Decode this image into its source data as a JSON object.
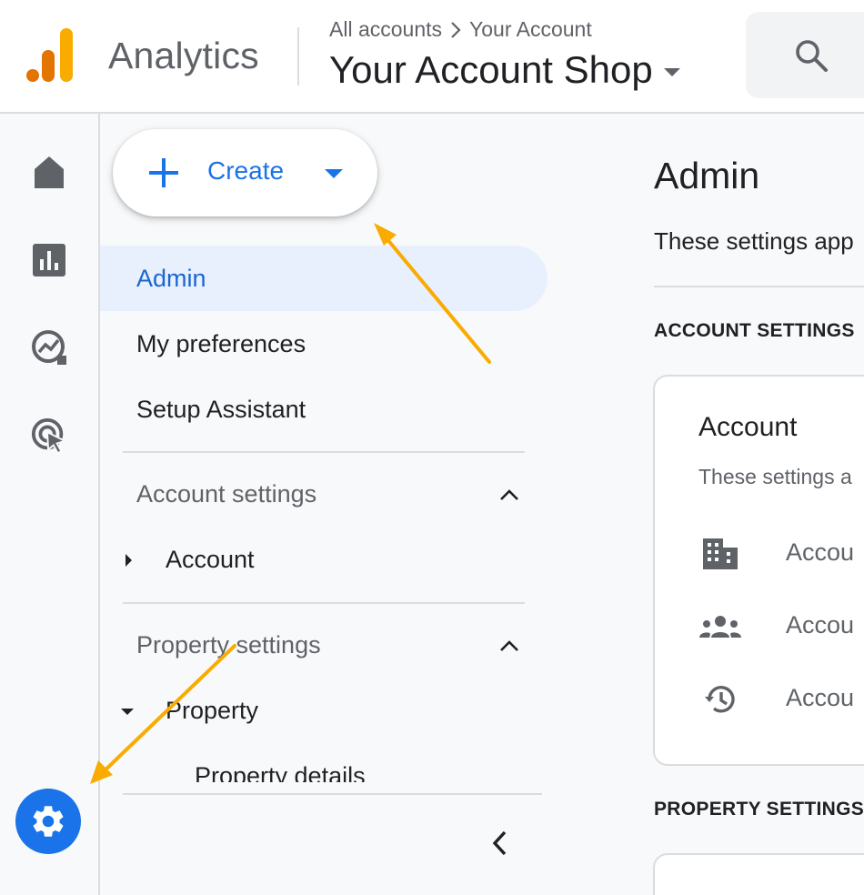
{
  "header": {
    "app_name": "Analytics",
    "breadcrumb": {
      "root": "All accounts",
      "current": "Your Account"
    },
    "account_name": "Your Account Shop",
    "brand_colors": {
      "orange": "#f9ab00",
      "dark_orange": "#e37400"
    }
  },
  "rail": {
    "items": [
      {
        "icon": "home-icon"
      },
      {
        "icon": "reports-icon"
      },
      {
        "icon": "explore-icon"
      },
      {
        "icon": "advertising-icon"
      }
    ],
    "settings_icon": "gear-icon",
    "accent": "#1a73e8"
  },
  "nav": {
    "create_label": "Create",
    "items": [
      {
        "label": "Admin",
        "active": true
      },
      {
        "label": "My preferences"
      },
      {
        "label": "Setup Assistant"
      }
    ],
    "account_settings": {
      "label": "Account settings",
      "child": "Account"
    },
    "property_settings": {
      "label": "Property settings",
      "child": "Property",
      "grandchild": "Property details"
    }
  },
  "main": {
    "title": "Admin",
    "description": "These settings app",
    "account_settings_heading": "ACCOUNT SETTINGS",
    "card": {
      "title": "Account",
      "description": "These settings a",
      "rows": [
        {
          "icon": "building-icon",
          "label": "Accou"
        },
        {
          "icon": "people-icon",
          "label": "Accou"
        },
        {
          "icon": "history-icon",
          "label": "Accou"
        }
      ]
    },
    "property_settings_heading": "PROPERTY SETTINGS"
  },
  "annotations": {
    "arrow_color": "#f9ab00"
  }
}
